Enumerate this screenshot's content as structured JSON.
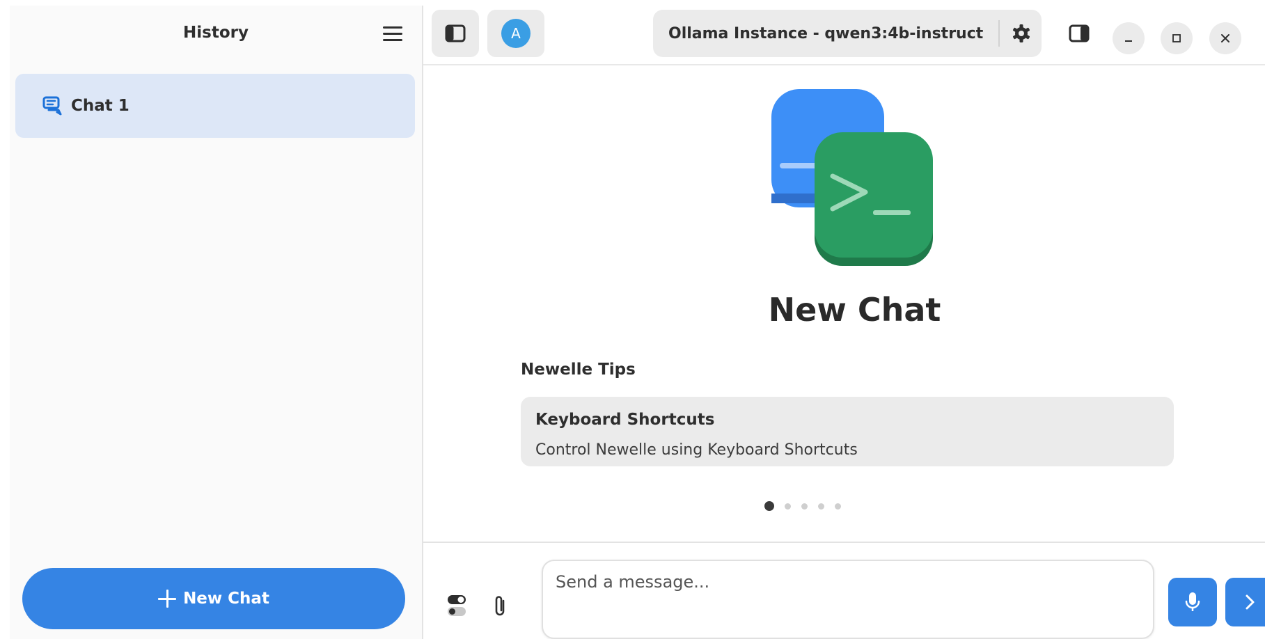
{
  "sidebar": {
    "title": "History",
    "chats": [
      {
        "label": "Chat 1",
        "icon": "chat-bubbles-icon",
        "selected": true
      }
    ],
    "new_chat_label": "New Chat"
  },
  "header": {
    "account_initial": "A",
    "model_label": "Ollama Instance - qwen3:4b-instruct",
    "icons": [
      "sidebar-toggle-icon",
      "gear-icon",
      "side-panel-icon",
      "minimize-icon",
      "maximize-icon",
      "close-icon"
    ]
  },
  "main": {
    "title": "New Chat",
    "tips_heading": "Newelle Tips",
    "tip": {
      "title": "Keyboard Shortcuts",
      "body": "Control Newelle using Keyboard Shortcuts"
    },
    "carousel": {
      "count": 5,
      "active_index": 0
    }
  },
  "input": {
    "placeholder": "Send a message...",
    "value": ""
  },
  "colors": {
    "accent": "#3584e4",
    "selected_item_bg": "#dde7f7",
    "button_bg": "#ebebeb",
    "logo_blue": "#3d8ff7",
    "logo_green": "#2a9d62"
  }
}
